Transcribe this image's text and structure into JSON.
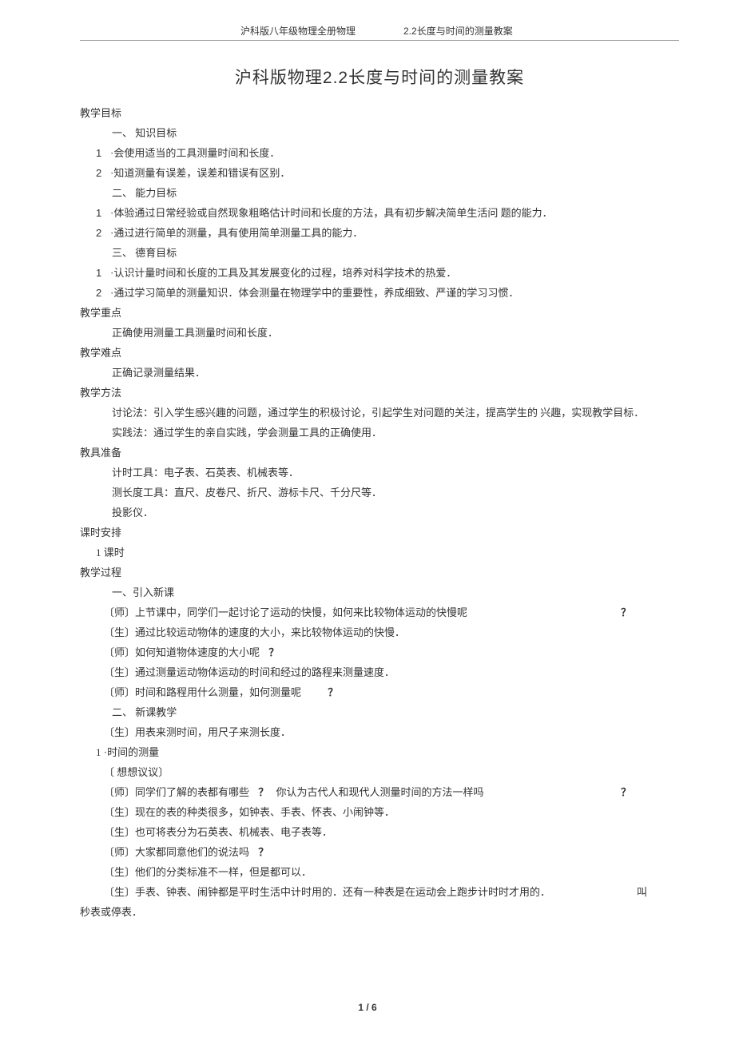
{
  "header": {
    "left": "沪科版八年级物理全册物理",
    "right_num": "2.2",
    "right_text": "长度与时间的测量教案"
  },
  "title": {
    "prefix": "沪科版物理",
    "num": "2.2",
    "suffix": "长度与时间的测量教案"
  },
  "sec_goal": "教学目标",
  "goal_1": "一、 知识目标",
  "goal_1_1": "·会使用适当的工具测量时间和长度．",
  "goal_1_2": "·知道测量有误差，误差和错误有区别．",
  "goal_2": "二、 能力目标",
  "goal_2_1": "·体验通过日常经验或自然现象粗略估计时间和长度的方法，具有初步解决简单生活问 题的能力．",
  "goal_2_2": "·通过进行简单的测量，具有使用简单测量工具的能力．",
  "goal_3": "三、 德育目标",
  "goal_3_1": "·认识计量时间和长度的工具及其发展变化的过程，培养对科学技术的热爱．",
  "goal_3_2": "·通过学习简单的测量知识．体会测量在物理学中的重要性，养成细致、严谨的学习习惯．",
  "sec_focus": "教学重点",
  "focus_text": "正确使用测量工具测量时间和长度．",
  "sec_diff": "教学难点",
  "diff_text": "正确记录测量结果．",
  "sec_method": "教学方法",
  "method_1": "讨论法：引入学生感兴趣的问题，通过学生的积极讨论，引起学生对问题的关注，提高学生的 兴趣，实现教学目标．",
  "method_2": "实践法：通过学生的亲自实践，学会测量工具的正确使用．",
  "sec_tools": "教具准备",
  "tools_1": "计时工具：电子表、石英表、机械表等．",
  "tools_2": "测长度工具：直尺、皮卷尺、折尺、游标卡尺、千分尺等．",
  "tools_3": "投影仪．",
  "sec_time": "课时安排",
  "time_text": "1 课时",
  "sec_process": "教学过程",
  "proc_intro": "一、引入新课",
  "dlg_1": "〔师〕上节课中，同学们一起讨论了运动的快慢，如何来比较物体运动的快慢呢",
  "dlg_2": "〔生〕通过比较运动物体的速度的大小，来比较物体运动的快慢．",
  "dlg_3": "〔师〕如何知道物体速度的大小呢",
  "dlg_4": "〔生〕通过测量运动物体运动的时间和经过的路程来测量速度．",
  "dlg_5": "〔师〕时间和路程用什么测量，如何测量呢",
  "proc_new": "二、 新课教学",
  "dlg_6": "〔生〕用表来测时间，用尺子来测长度．",
  "topic_1": "1 ·时间的测量",
  "think": "〔 想想议议〕",
  "dlg_7a": "〔师〕同学们了解的表都有哪些",
  "dlg_7b": "你认为古代人和现代人测量时间的方法一样吗",
  "dlg_8": "〔生〕现在的表的种类很多，如钟表、手表、怀表、小闹钟等．",
  "dlg_9": "〔生〕也可将表分为石英表、机械表、电子表等．",
  "dlg_10": "〔师〕大家都同意他们的说法吗",
  "dlg_11": "〔生〕他们的分类标准不一样，但是都可以．",
  "dlg_12": "〔生〕手表、钟表、闹钟都是平时生活中计时用的．还有一种表是在运动会上跑步计时时才用的．",
  "dlg_12_tail": "叫",
  "dlg_12_cont": "秒表或停表．",
  "q": "？",
  "page": "1 / 6"
}
